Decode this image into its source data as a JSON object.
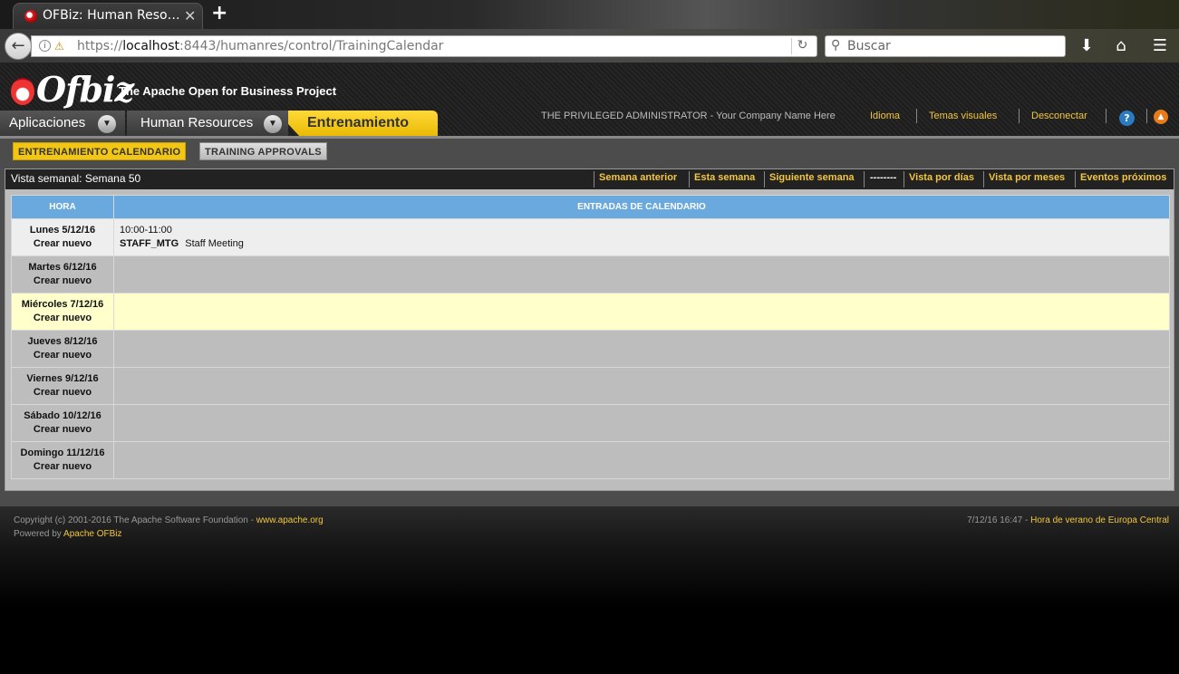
{
  "browser": {
    "tab_title": "OFBiz: Human Reso…",
    "tab_close": "✕",
    "new_tab": "+",
    "url_prefix": "https://",
    "url_host": "localhost",
    "url_rest": ":8443/humanres/control/TrainingCalendar",
    "search_placeholder": "Buscar"
  },
  "header": {
    "logo": "Ofbiz",
    "tagline": "The Apache Open for Business Project",
    "apps_label": "Aplicaciones",
    "module_label": "Human Resources",
    "active_app": "Entrenamiento",
    "user_name": "THE PRIVILEGED ADMINISTRATOR - Your Company Name Here",
    "links": [
      "Idioma",
      "Temas visuales",
      "Desconectar"
    ],
    "help": "?",
    "up": "▲"
  },
  "subnav": {
    "tabs": [
      "ENTRENAMIENTO CALENDARIO",
      "TRAINING APPROVALS"
    ]
  },
  "calendar": {
    "title": "Vista semanal: Semana 50",
    "nav_links": [
      "Semana anterior",
      "Esta semana",
      "Siguiente semana",
      "--------",
      "Vista por días",
      "Vista por meses",
      "Eventos próximos"
    ],
    "col_hour": "HORA",
    "col_entries": "ENTRADAS DE CALENDARIO",
    "create_label": "Crear nuevo",
    "days": [
      {
        "label": "Lunes 5/12/16",
        "time": "10:00-11:00",
        "code": "STAFF_MTG",
        "desc": "Staff Meeting"
      },
      {
        "label": "Martes 6/12/16"
      },
      {
        "label": "Miércoles 7/12/16"
      },
      {
        "label": "Jueves 8/12/16"
      },
      {
        "label": "Viernes 9/12/16"
      },
      {
        "label": "Sábado 10/12/16"
      },
      {
        "label": "Domingo 11/12/16"
      }
    ]
  },
  "footer": {
    "copyright": "Copyright (c) 2001-2016 The Apache Software Foundation - ",
    "apache_link": "www.apache.org",
    "powered": "Powered by ",
    "ofbiz_link": "Apache OFBiz",
    "datetime": "7/12/16 16:47 - ",
    "timezone": "Hora de verano de Europa Central"
  },
  "colors": {
    "accent": "#f3c63c",
    "table_header": "#6aa9de",
    "today_row": "#ffffcc"
  }
}
